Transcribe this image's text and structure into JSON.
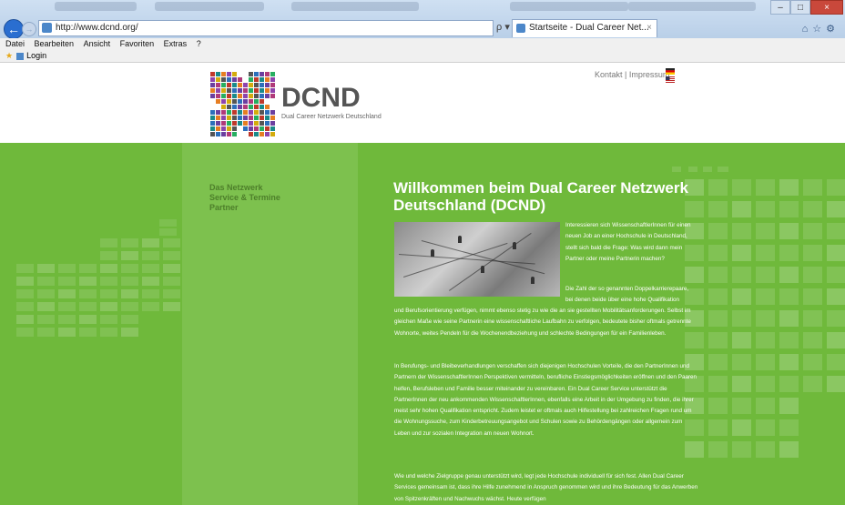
{
  "browser": {
    "url": "http://www.dcnd.org/",
    "address_tools": "ρ ▾ C",
    "tab_title": "Startseite - Dual Career Net...",
    "tab_close": "×",
    "menu": [
      "Datei",
      "Bearbeiten",
      "Ansicht",
      "Favoriten",
      "Extras",
      "?"
    ],
    "favorites": [
      "Login"
    ],
    "window_buttons": [
      "–",
      "□",
      "×"
    ]
  },
  "header": {
    "logo_text": "DCND",
    "logo_subtitle": "Dual Career Netzwerk Deutschland",
    "top_links": {
      "kontakt": "Kontakt",
      "separator": "|",
      "impressum": "Impressum"
    }
  },
  "nav": [
    "Das Netzwerk",
    "Service & Termine",
    "Partner"
  ],
  "main": {
    "heading": "Willkommen beim Dual Career Netzwerk Deutschland (DCND)",
    "paragraph_1": "Interessieren sich WissenschaftlerInnen für einen neuen Job an einer Hochschule in Deutschland, stellt sich bald die Frage: Was wird dann mein Partner oder meine Partnerin machen?",
    "paragraph_2a": "Die Zahl der so genannten Doppelkarrierepaare, bei denen beide über eine hohe Qualifikation",
    "paragraph_2b": "und Berufsorientierung verfügen, nimmt ebenso stetig zu wie die an sie gestellten Mobilitätsanforderungen. Selbst im gleichen Maße wie seine Partnerin eine wissenschaftliche Laufbahn zu verfolgen, bedeutete bisher oftmals getrennte Wohnorte, weites Pendeln für die Wochenendbeziehung und schlechte Bedingungen für ein Familienleben.",
    "paragraph_3": "In Berufungs- und Bleibeverhandlungen verschaffen sich diejenigen Hochschulen Vorteile, die den PartnerInnen und Partnern der WissenschaftlerInnen Perspektiven vermitteln, berufliche Einstiegsmöglichkeiten eröffnen und den Paaren helfen, Berufsleben und Familie besser miteinander zu vereinbaren. Ein Dual Career Service unterstützt die PartnerInnen der neu ankommenden WissenschaftlerInnen, ebenfalls eine Arbeit in der Umgebung zu finden, die ihrer meist sehr hohen Qualifikation entspricht. Zudem leistet er oftmals auch Hilfestellung bei zahlreichen Fragen rund um die Wohnungssuche, zum Kinderbetreuungsangebot und Schulen sowie zu Behördengängen oder allgemein zum Leben und zur sozialen Integration am neuen Wohnort.",
    "paragraph_4": "Wie und welche Zielgruppe genau unterstützt wird, legt jede Hochschule individuell für sich fest. Allen Dual Career Services gemeinsam ist, dass ihre Hilfe zunehmend in Anspruch genommen wird und ihre Bedeutung für das Anwerben von Spitzenkräften und Nachwuchs wächst. Heute verfügen"
  },
  "colors": {
    "green": "#6fb93b",
    "nav_green": "#7dc14e",
    "nav_text": "#4d7f2a"
  }
}
